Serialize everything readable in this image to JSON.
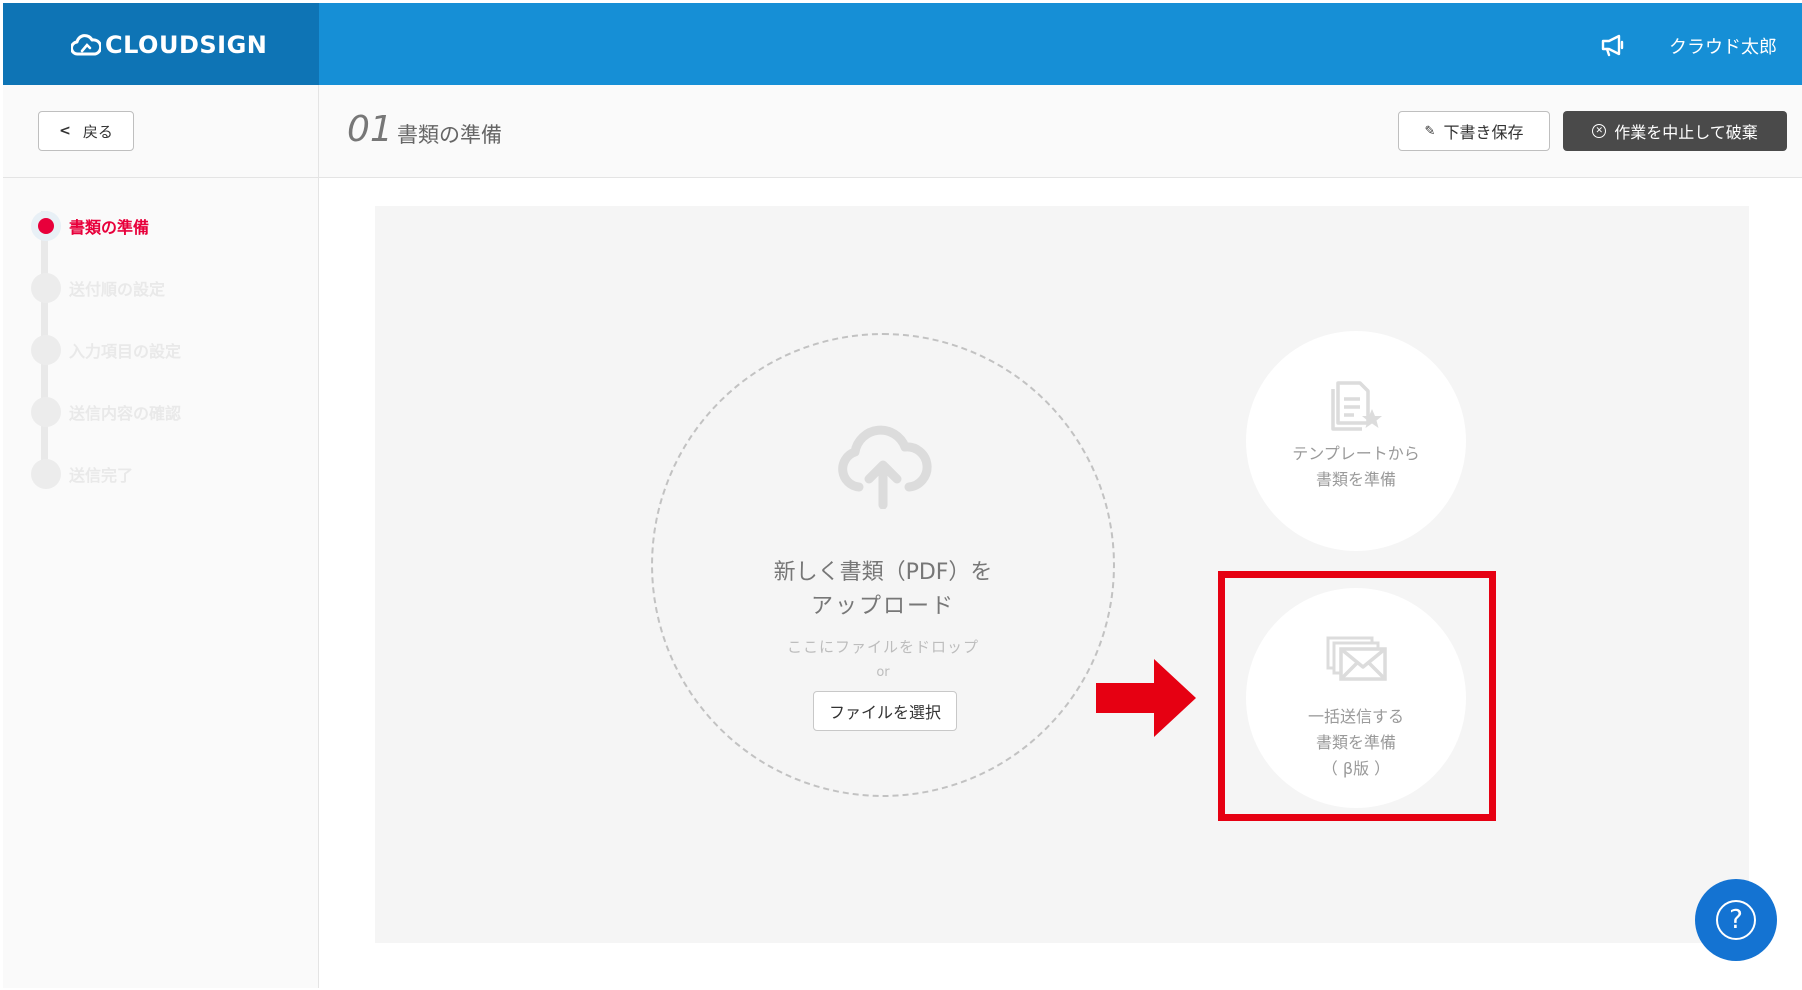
{
  "header": {
    "brand": "CLOUDSIGN",
    "user_name": "クラウド太郎",
    "icons": [
      "cloud-logo-icon",
      "megaphone-icon"
    ]
  },
  "toolbar": {
    "back_label": "戻る",
    "step_number": "01",
    "step_title": "書類の準備",
    "draft_label": "下書き保存",
    "abort_label": "作業を中止して破棄"
  },
  "sidebar": {
    "steps": [
      {
        "label": "書類の準備",
        "active": true
      },
      {
        "label": "送付順の設定",
        "active": false
      },
      {
        "label": "入力項目の設定",
        "active": false
      },
      {
        "label": "送信内容の確認",
        "active": false
      },
      {
        "label": "送信完了",
        "active": false
      }
    ]
  },
  "main": {
    "upload": {
      "title_line1": "新しく書類（PDF）を",
      "title_line2": "アップロード",
      "drop_hint": "ここにファイルをドロップ",
      "or_text": "or",
      "select_button": "ファイルを選択"
    },
    "template_option": {
      "line1": "テンプレートから",
      "line2": "書類を準備"
    },
    "bulk_option": {
      "line1": "一括送信する",
      "line2": "書類を準備",
      "line3": "（ β版 ）"
    }
  },
  "colors": {
    "header_blue": "#168fd6",
    "logo_blue": "#0e74b5",
    "active_red": "#e8003b",
    "highlight_red": "#e60012",
    "help_blue": "#1473d2"
  },
  "help": {
    "icon": "question-icon",
    "symbol": "?"
  }
}
